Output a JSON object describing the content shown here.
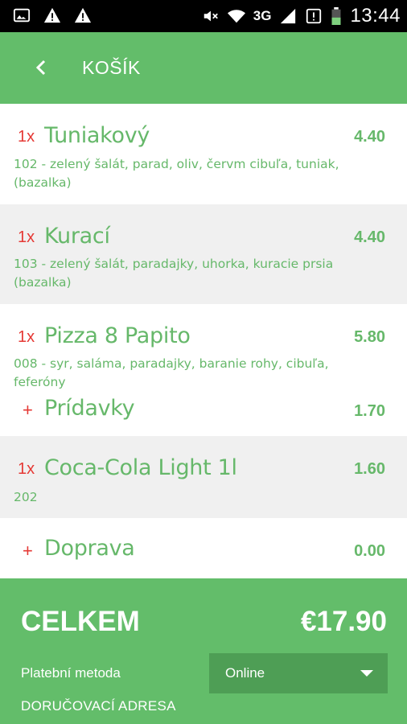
{
  "status_bar": {
    "time": "13:44",
    "network": "3G",
    "icons": [
      "image-icon",
      "warning-icon",
      "warning-icon",
      "mute-icon",
      "wifi-icon",
      "signal-icon",
      "sim-alert-icon",
      "battery-icon"
    ]
  },
  "toolbar": {
    "back_icon": "chevron-left-icon",
    "title": "KOŠÍK"
  },
  "items": [
    {
      "qty": "1x",
      "name": "Tuniakový",
      "price": "4.40",
      "desc": "102 - zelený šalát, parad, oliv, červm cibuľa, tuniak, (bazalka)"
    },
    {
      "qty": "1x",
      "name": "Kurací",
      "price": "4.40",
      "desc": "103 - zelený šalát, paradajky, uhorka, kuracie prsia (bazalka)"
    },
    {
      "qty": "1x",
      "name": "Pizza 8 Papito",
      "price": "5.80",
      "desc": "008 - syr, saláma, paradajky, baranie rohy, cibuľa, feferóny",
      "extra": {
        "sign": "+",
        "name": "Prídavky",
        "price": "1.70"
      }
    },
    {
      "qty": "1x",
      "name": "Coca-Cola Light 1l",
      "price": "1.60",
      "desc": "202"
    }
  ],
  "delivery": {
    "sign": "+",
    "name": "Doprava",
    "price": "0.00"
  },
  "footer": {
    "total_label": "CELKEM",
    "total_value": "€17.90",
    "payment_label": "Platební metoda",
    "payment_value": "Online",
    "address_label": "DORUČOVACÍ ADRESA"
  },
  "colors": {
    "accent": "#63bd6a",
    "text_green": "#66b86a",
    "red": "#e53935"
  }
}
